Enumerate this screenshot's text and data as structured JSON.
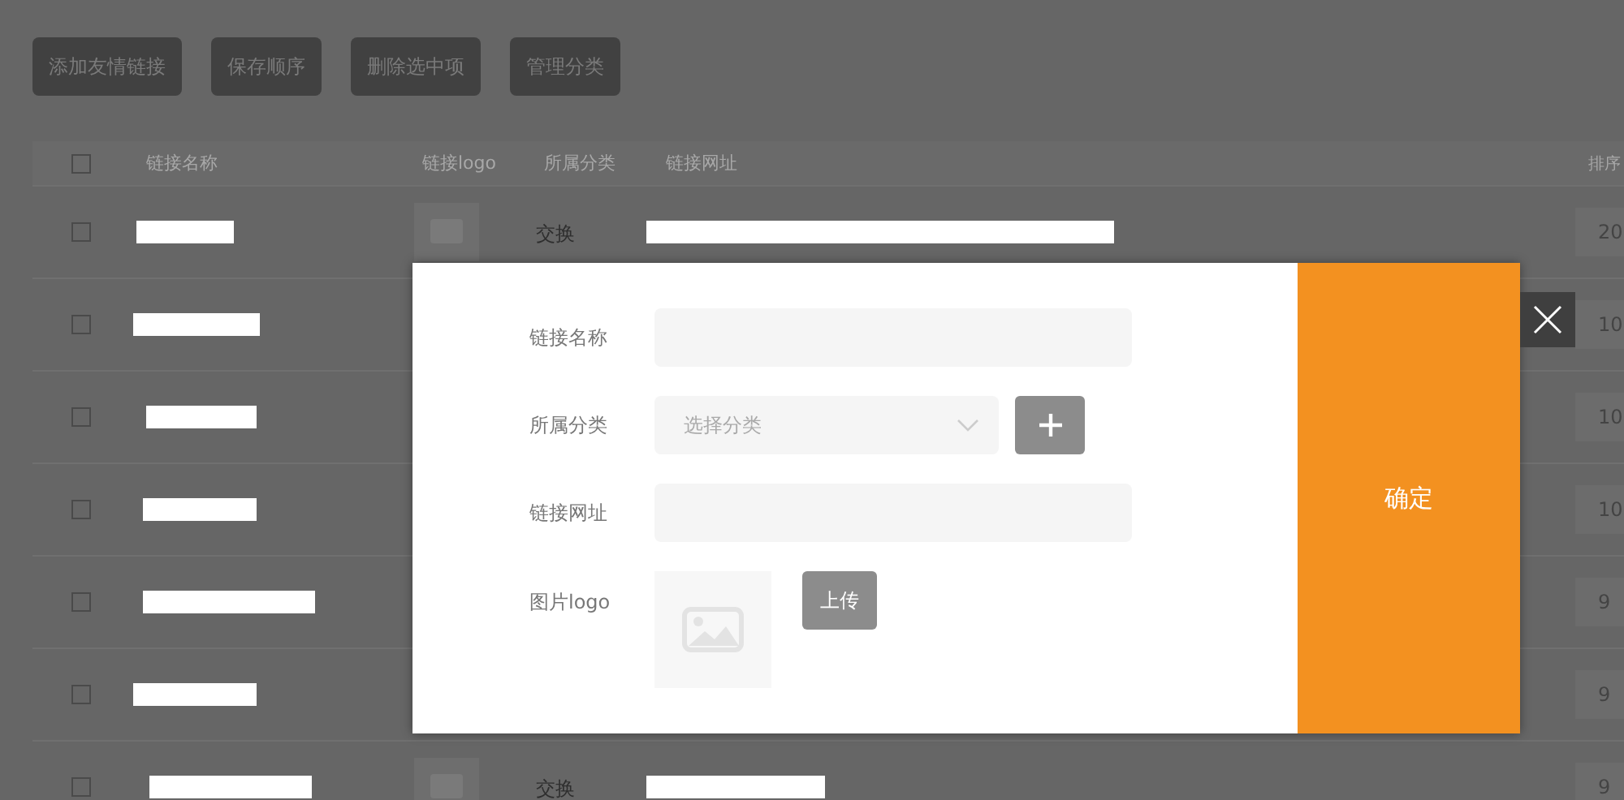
{
  "toolbar": {
    "buttons": [
      "添加友情链接",
      "保存顺序",
      "删除选中项",
      "管理分类"
    ]
  },
  "table": {
    "select_all": {
      "checked": false
    },
    "columns": [
      "链接名称",
      "链接logo",
      "所属分类",
      "链接网址",
      "排序"
    ],
    "rows": [
      {
        "checked": false,
        "category": "交换",
        "sort": "20"
      },
      {
        "checked": false,
        "sort": "10"
      },
      {
        "checked": false,
        "sort": "10"
      },
      {
        "checked": false,
        "sort": "10"
      },
      {
        "checked": false,
        "sort": "9"
      },
      {
        "checked": false,
        "sort": "9"
      },
      {
        "checked": false,
        "category": "交换",
        "sort": "9"
      }
    ]
  },
  "dialog": {
    "fields": [
      {
        "kind": "text",
        "label": "链接名称"
      },
      {
        "kind": "select",
        "label": "所属分类",
        "placeholder": "选择分类"
      },
      {
        "kind": "text",
        "label": "链接网址"
      },
      {
        "kind": "image",
        "label": "图片logo",
        "button": "上传"
      }
    ],
    "confirm": "确定"
  }
}
